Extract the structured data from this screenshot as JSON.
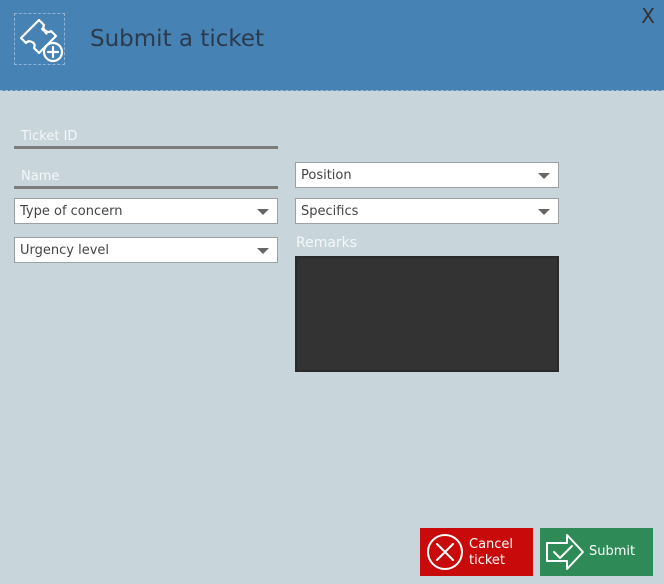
{
  "header": {
    "title": "Submit a ticket",
    "close_label": "X",
    "icon": "ticket-add-icon",
    "background": "#4682b4"
  },
  "form": {
    "ticket_id_placeholder": "Ticket ID",
    "name_placeholder": "Name",
    "type_of_concern": "Type of concern",
    "urgency_level": "Urgency level",
    "position": "Position",
    "specifics": "Specifics",
    "remarks_label": "Remarks"
  },
  "buttons": {
    "cancel_line1": "Cancel",
    "cancel_line2": "ticket",
    "submit": "Submit",
    "cancel_color": "#c80a0a",
    "submit_color": "#2e8b57"
  }
}
